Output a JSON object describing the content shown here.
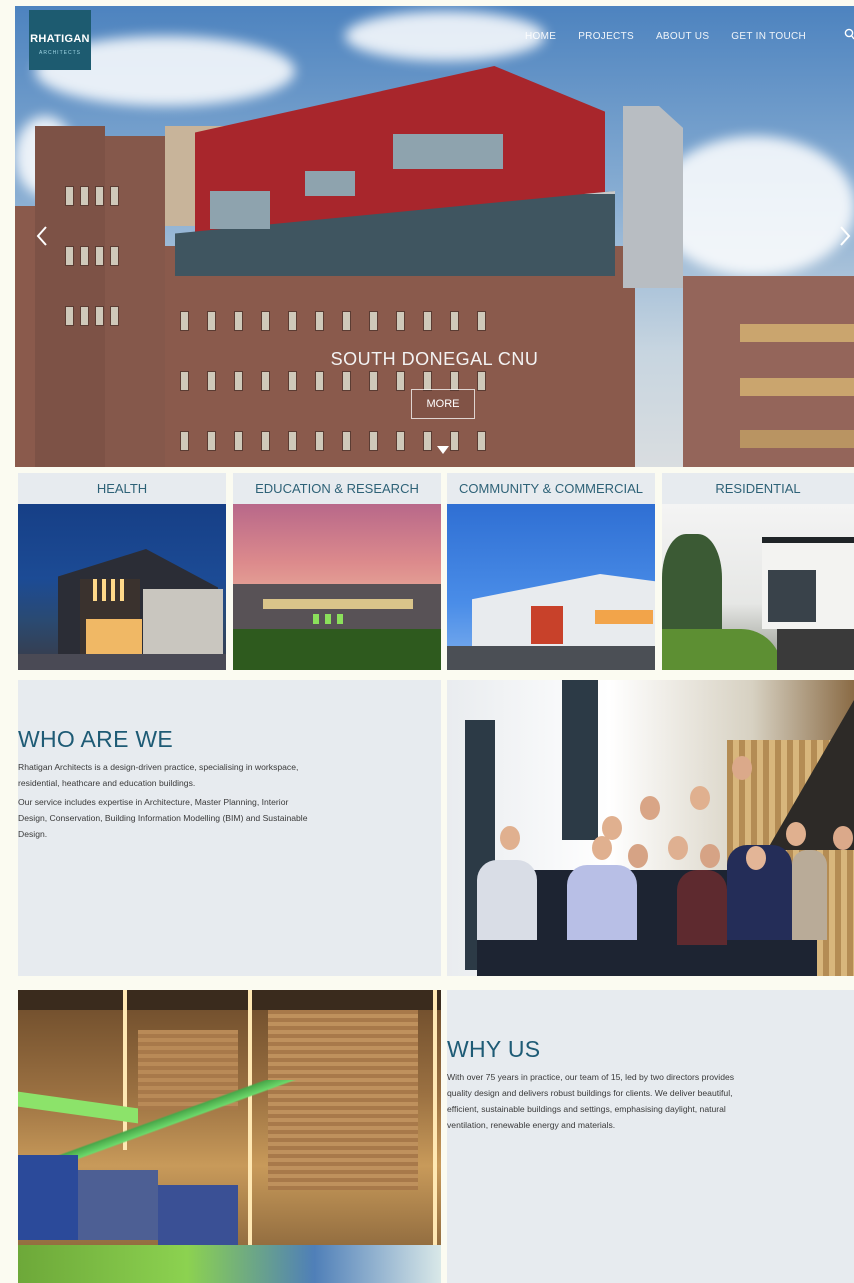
{
  "logo": {
    "line1": "RHATIGAN",
    "line2": "ARCHITECTS"
  },
  "nav": [
    "HOME",
    "PROJECTS",
    "ABOUT US",
    "GET IN TOUCH"
  ],
  "hero": {
    "title": "SOUTH DONEGAL CNU",
    "button": "MORE"
  },
  "categories": [
    {
      "label": "HEALTH"
    },
    {
      "label": "EDUCATION & RESEARCH"
    },
    {
      "label": "COMMUNITY & COMMERCIAL"
    },
    {
      "label": "RESIDENTIAL"
    }
  ],
  "who": {
    "heading": "WHO ARE WE",
    "p1": "Rhatigan Architects is a design-driven practice, specialising in workspace, residential, heathcare and education buildings.",
    "p2": "Our service includes expertise in Architecture, Master Planning, Interior Design, Conservation, Building Information Modelling (BIM) and Sustainable Design."
  },
  "why": {
    "heading": "WHY US",
    "p1": "With over 75 years in practice, our team of 15, led by two directors provides quality design and delivers robust buildings for clients. We deliver beautiful, efficient, sustainable buildings and settings, emphasising daylight, natural ventilation, renewable energy and materials."
  },
  "colors": {
    "accent": "#1e5b75",
    "panel": "#e7ebef",
    "brick": "#8a5a4c",
    "red_cladding": "#a8262c"
  },
  "icons": [
    "search-icon",
    "chevron-left-icon",
    "chevron-right-icon",
    "caret-down-icon"
  ]
}
